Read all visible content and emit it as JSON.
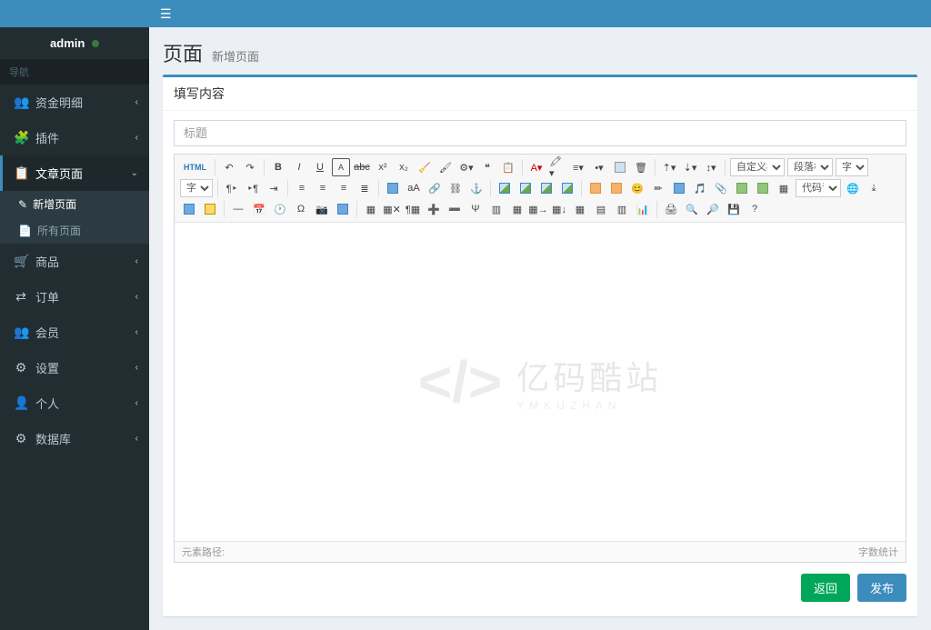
{
  "user": {
    "name": "admin"
  },
  "sidebar": {
    "nav_header": "导航",
    "items": [
      {
        "label": "资金明细",
        "icon": "👥"
      },
      {
        "label": "插件",
        "icon": "🧩"
      },
      {
        "label": "文章页面",
        "icon": "📋"
      },
      {
        "label": "商品",
        "icon": "🛒"
      },
      {
        "label": "订单",
        "icon": "⇄"
      },
      {
        "label": "会员",
        "icon": "👥"
      },
      {
        "label": "设置",
        "icon": "⚙"
      },
      {
        "label": "个人",
        "icon": "👤"
      },
      {
        "label": "数据库",
        "icon": "⚙"
      }
    ],
    "sub": {
      "add_page": "新增页面",
      "all_pages": "所有页面"
    }
  },
  "header": {
    "title": "页面",
    "subtitle": "新增页面"
  },
  "box": {
    "title": "填写内容",
    "title_placeholder": "标题"
  },
  "editor": {
    "html_btn": "HTML",
    "selects": {
      "custom_title": "自定义标…",
      "block_format": "段落格式",
      "font_family": "字体",
      "font_size": "字号",
      "code_lang": "代码语言"
    },
    "status_left": "元素路径:",
    "status_right": "字数统计"
  },
  "watermark": {
    "cn": "亿码酷站",
    "en": "YMKUZHAN"
  },
  "actions": {
    "back": "返回",
    "publish": "发布"
  }
}
